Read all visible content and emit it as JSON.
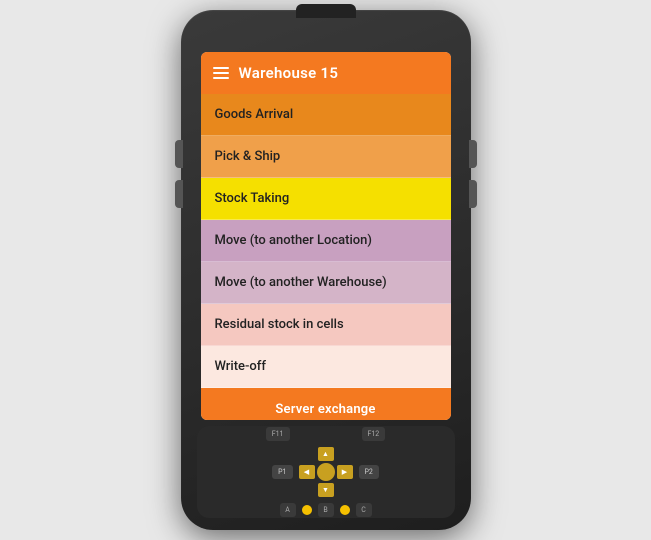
{
  "device": {
    "screen": {
      "header": {
        "title": "Warehouse 15",
        "menu_icon": "hamburger-icon"
      },
      "menu_items": [
        {
          "id": "goods-arrival",
          "label": "Goods Arrival",
          "color_class": "mi-goods-arrival"
        },
        {
          "id": "pick-ship",
          "label": "Pick & Ship",
          "color_class": "mi-pick-ship"
        },
        {
          "id": "stock-taking",
          "label": "Stock Taking",
          "color_class": "mi-stock-taking"
        },
        {
          "id": "move-location",
          "label": "Move (to another Location)",
          "color_class": "mi-move-location"
        },
        {
          "id": "move-warehouse",
          "label": "Move (to another Warehouse)",
          "color_class": "mi-move-warehouse"
        },
        {
          "id": "residual-stock",
          "label": "Residual stock in cells",
          "color_class": "mi-residual"
        },
        {
          "id": "write-off",
          "label": "Write-off",
          "color_class": "mi-writeoff"
        }
      ],
      "server_exchange_btn": "Server exchange"
    },
    "keypad": {
      "fn_keys": [
        "F11",
        "F12"
      ],
      "p_keys": [
        "P1",
        "P2"
      ],
      "alpha_keys": [
        "A",
        "B",
        "C"
      ]
    }
  }
}
